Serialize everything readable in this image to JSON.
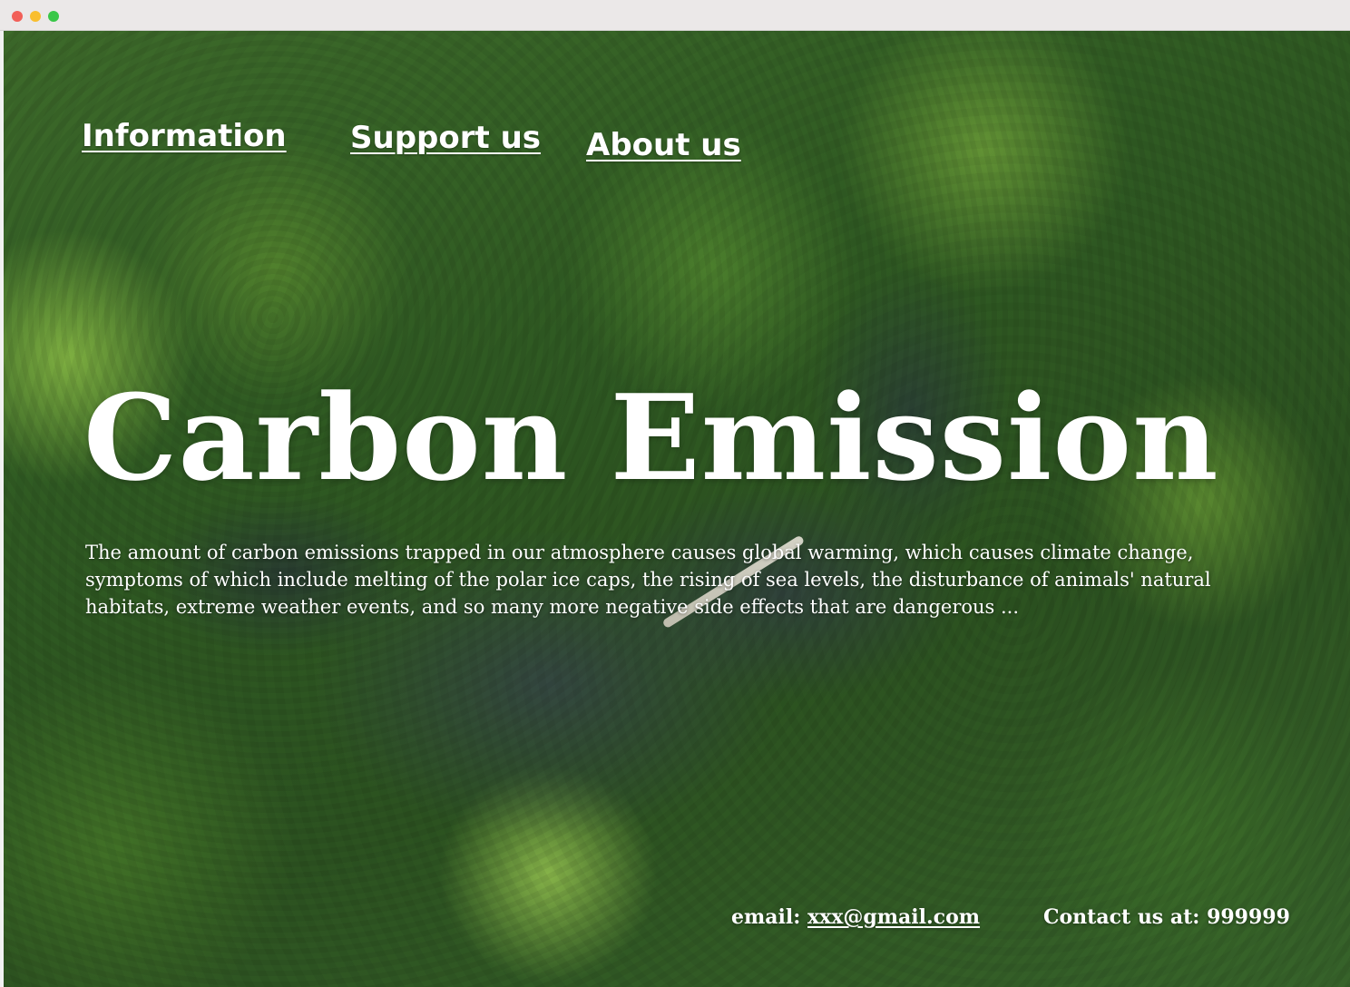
{
  "window": {
    "controls": [
      {
        "name": "close",
        "color": "#f25f58"
      },
      {
        "name": "minimize",
        "color": "#f9be2e"
      },
      {
        "name": "zoom",
        "color": "#39c748"
      }
    ]
  },
  "nav": {
    "items": [
      {
        "label": "Information"
      },
      {
        "label": "Support us"
      },
      {
        "label": "About us"
      }
    ]
  },
  "hero": {
    "title": "Carbon Emission",
    "text": "The amount of carbon emissions trapped in our atmosphere causes global warming, which causes climate change, symptoms of which include melting of the polar ice caps, the rising of sea levels, the disturbance of animals' natural habitats, extreme weather events, and so many more negative side effects that are dangerous ..."
  },
  "footer": {
    "email_label": "email:",
    "email_value": "xxx@gmail.com",
    "contact_label": "Contact us at:",
    "contact_value": "999999"
  },
  "background": {
    "subject": "aerial view of forest canopy and river",
    "palette": [
      "#2f5a22",
      "#3d6a2a",
      "#344642"
    ]
  }
}
